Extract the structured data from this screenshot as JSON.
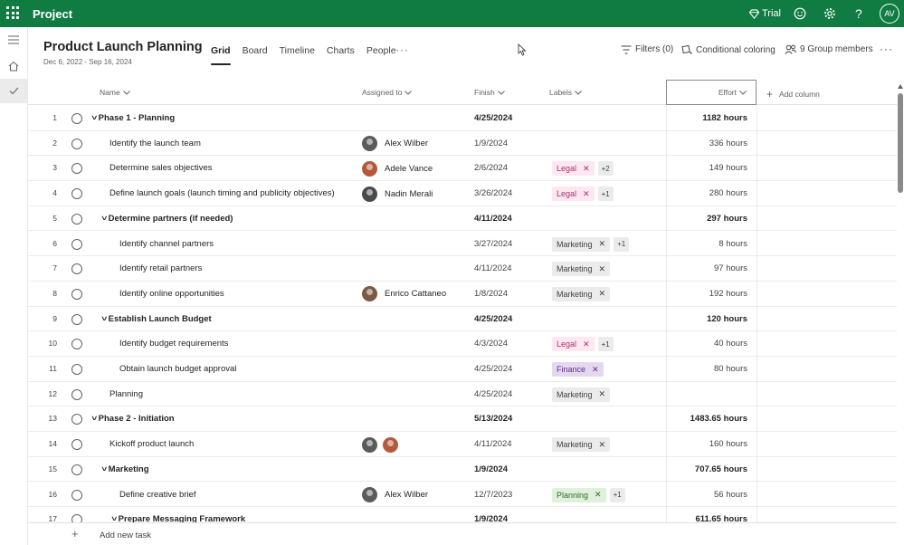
{
  "app": {
    "name": "Project"
  },
  "topbar": {
    "trial_label": "Trial",
    "avatar_initials": "AV"
  },
  "project": {
    "title": "Product Launch Planning",
    "date_range": "Dec 6, 2022 - Sep 16, 2024"
  },
  "tabs": [
    {
      "label": "Grid",
      "active": true
    },
    {
      "label": "Board",
      "active": false
    },
    {
      "label": "Timeline",
      "active": false
    },
    {
      "label": "Charts",
      "active": false
    },
    {
      "label": "People",
      "active": false
    }
  ],
  "commands": {
    "filters": "Filters (0)",
    "conditional_coloring": "Conditional coloring",
    "group_members": "9 Group members"
  },
  "columns": {
    "name": "Name",
    "assigned": "Assigned to",
    "finish": "Finish",
    "labels": "Labels",
    "effort": "Effort",
    "add_column": "Add column"
  },
  "add_task": "Add new task",
  "rows": [
    {
      "num": "1",
      "name": "Phase 1 - Planning",
      "level": 0,
      "summary": true,
      "finish": "4/25/2024",
      "effort": "1182 hours",
      "assignees": [],
      "labels": [],
      "more": ""
    },
    {
      "num": "2",
      "name": "Identify the launch team",
      "level": 1,
      "summary": false,
      "finish": "1/9/2024",
      "effort": "336 hours",
      "assignees": [
        {
          "person": "alex",
          "name": "Alex Wilber"
        }
      ],
      "labels": [],
      "more": ""
    },
    {
      "num": "3",
      "name": "Determine sales objectives",
      "level": 1,
      "summary": false,
      "finish": "2/6/2024",
      "effort": "149 hours",
      "assignees": [
        {
          "person": "adele",
          "name": "Adele Vance"
        }
      ],
      "labels": [
        {
          "text": "Legal",
          "kind": "legal"
        }
      ],
      "more": "+2"
    },
    {
      "num": "4",
      "name": "Define launch goals (launch timing and publicity objectives)",
      "level": 1,
      "summary": false,
      "finish": "3/26/2024",
      "effort": "280 hours",
      "assignees": [
        {
          "person": "nadin",
          "name": "Nadin Merali"
        }
      ],
      "labels": [
        {
          "text": "Legal",
          "kind": "legal"
        }
      ],
      "more": "+1"
    },
    {
      "num": "5",
      "name": "Determine partners (if needed)",
      "level": 1,
      "summary": true,
      "finish": "4/11/2024",
      "effort": "297 hours",
      "assignees": [],
      "labels": [],
      "more": ""
    },
    {
      "num": "6",
      "name": "Identify channel partners",
      "level": 2,
      "summary": false,
      "finish": "3/27/2024",
      "effort": "8 hours",
      "assignees": [],
      "labels": [
        {
          "text": "Marketing",
          "kind": "marketing"
        }
      ],
      "more": "+1"
    },
    {
      "num": "7",
      "name": "Identify retail partners",
      "level": 2,
      "summary": false,
      "finish": "4/11/2024",
      "effort": "97 hours",
      "assignees": [],
      "labels": [
        {
          "text": "Marketing",
          "kind": "marketing"
        }
      ],
      "more": ""
    },
    {
      "num": "8",
      "name": "Identify online opportunities",
      "level": 2,
      "summary": false,
      "finish": "1/8/2024",
      "effort": "192 hours",
      "assignees": [
        {
          "person": "enrico",
          "name": "Enrico Cattaneo"
        }
      ],
      "labels": [
        {
          "text": "Marketing",
          "kind": "marketing"
        }
      ],
      "more": ""
    },
    {
      "num": "9",
      "name": "Establish Launch Budget",
      "level": 1,
      "summary": true,
      "finish": "4/25/2024",
      "effort": "120 hours",
      "assignees": [],
      "labels": [],
      "more": ""
    },
    {
      "num": "10",
      "name": "Identify budget requirements",
      "level": 2,
      "summary": false,
      "finish": "4/3/2024",
      "effort": "40 hours",
      "assignees": [],
      "labels": [
        {
          "text": "Legal",
          "kind": "legal"
        }
      ],
      "more": "+1"
    },
    {
      "num": "11",
      "name": "Obtain launch budget approval",
      "level": 2,
      "summary": false,
      "finish": "4/25/2024",
      "effort": "80 hours",
      "assignees": [],
      "labels": [
        {
          "text": "Finance",
          "kind": "finance"
        }
      ],
      "more": ""
    },
    {
      "num": "12",
      "name": "Planning",
      "level": 1,
      "summary": false,
      "finish": "4/25/2024",
      "effort": "",
      "assignees": [],
      "labels": [
        {
          "text": "Marketing",
          "kind": "marketing"
        }
      ],
      "more": ""
    },
    {
      "num": "13",
      "name": "Phase 2 - Initiation",
      "level": 0,
      "summary": true,
      "finish": "5/13/2024",
      "effort": "1483.65 hours",
      "assignees": [],
      "labels": [],
      "more": ""
    },
    {
      "num": "14",
      "name": "Kickoff product launch",
      "level": 1,
      "summary": false,
      "finish": "4/11/2024",
      "effort": "160 hours",
      "assignees": [
        {
          "person": "alex",
          "name": ""
        },
        {
          "person": "adele",
          "name": ""
        }
      ],
      "labels": [
        {
          "text": "Marketing",
          "kind": "marketing"
        }
      ],
      "more": ""
    },
    {
      "num": "15",
      "name": "Marketing",
      "level": 1,
      "summary": true,
      "finish": "1/9/2024",
      "effort": "707.65 hours",
      "assignees": [],
      "labels": [],
      "more": ""
    },
    {
      "num": "16",
      "name": "Define creative brief",
      "level": 2,
      "summary": false,
      "finish": "12/7/2023",
      "effort": "56 hours",
      "assignees": [
        {
          "person": "alex",
          "name": "Alex Wilber"
        }
      ],
      "labels": [
        {
          "text": "Planning",
          "kind": "planning"
        }
      ],
      "more": "+1"
    },
    {
      "num": "17",
      "name": "Prepare Messaging Framework",
      "level": 2,
      "summary": true,
      "finish": "1/9/2024",
      "effort": "611.65 hours",
      "assignees": [],
      "labels": [],
      "more": ""
    }
  ]
}
